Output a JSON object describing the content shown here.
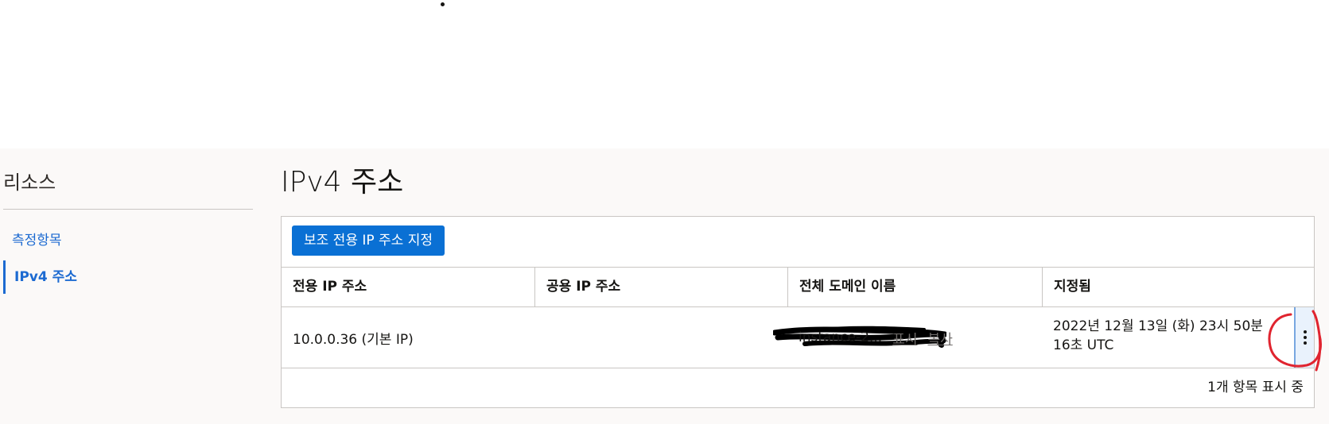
{
  "sidebar": {
    "title": "리소스",
    "items": [
      {
        "label": "측정항목",
        "active": false
      },
      {
        "label": "IPv4 주소",
        "active": true
      }
    ]
  },
  "main": {
    "title": "IPv4 주소",
    "assign_button": "보조 전용 IP 주소 지정",
    "table": {
      "columns": [
        "전용 IP 주소",
        "공용 IP 주소",
        "전체 도메인 이름",
        "지정됨"
      ],
      "rows": [
        {
          "private_ip": "10.0.0.36 (기본 IP)",
          "fqdn": "instance-2...",
          "show_link": "표시",
          "copy_link": "복사",
          "assigned": "2022년 12월 13일 (화) 23시 50분 16초 UTC"
        }
      ]
    },
    "footer_count": "1개 항목 표시 중"
  },
  "icons": {
    "row_actions": "kebab-menu-icon",
    "annotation": "red-circle-annotation"
  },
  "colors": {
    "accent": "#0a70d4",
    "link": "#1c6ad1",
    "annotation": "#e0242f"
  }
}
